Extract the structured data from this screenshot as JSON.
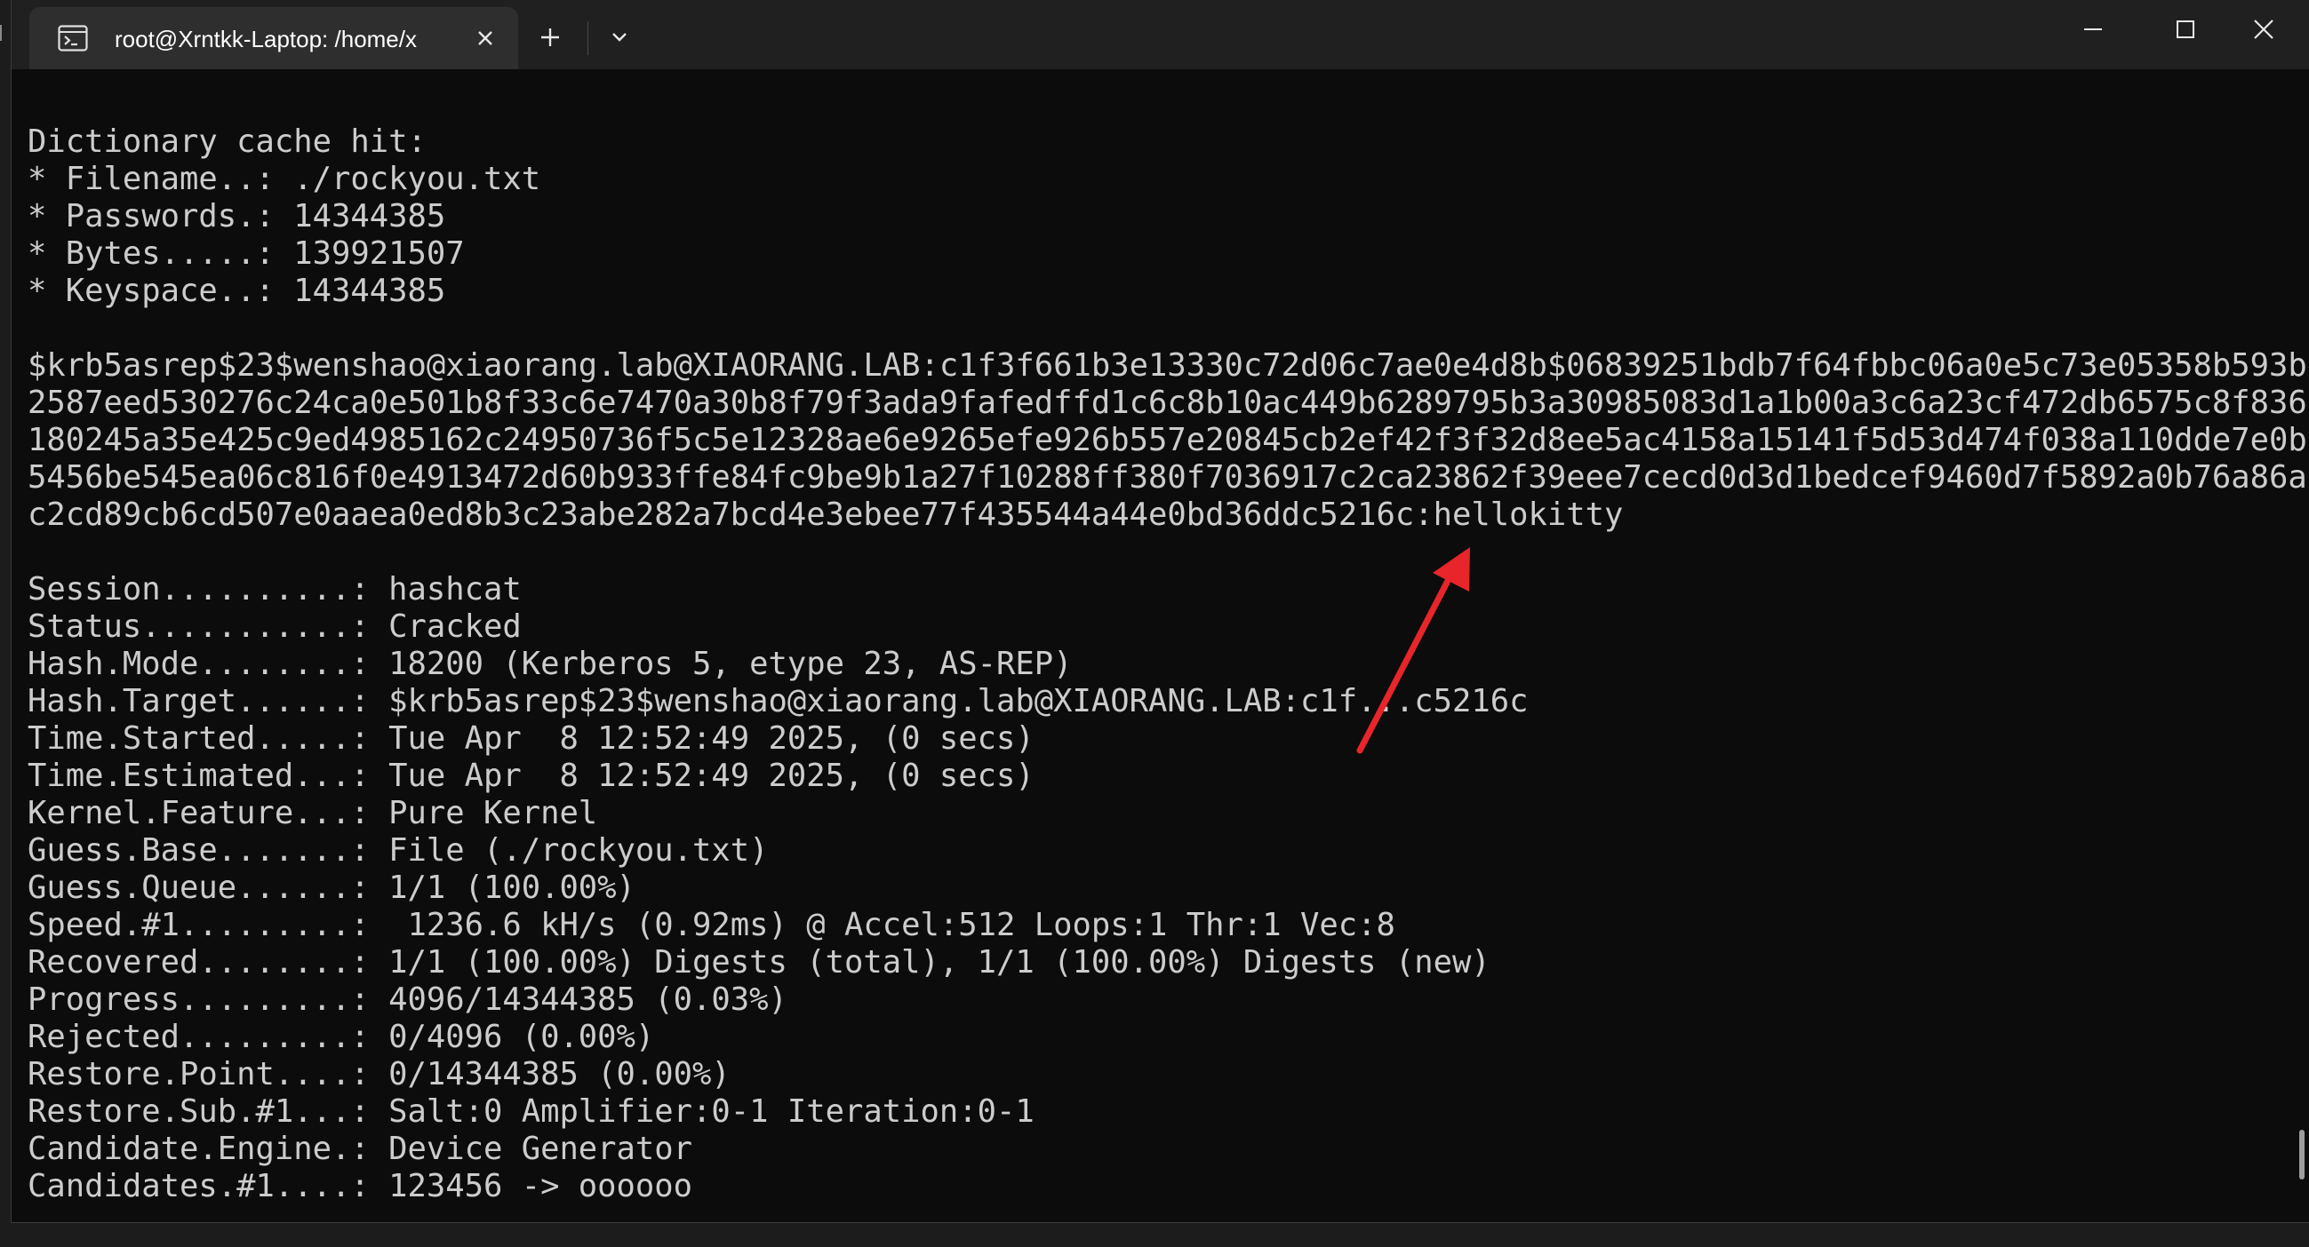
{
  "window": {
    "tab_title": "root@Xrntkk-Laptop: /home/x",
    "icons": {
      "tab_icon": "terminal-icon",
      "tab_close": "close-icon",
      "new_tab": "plus-icon",
      "dropdown": "chevron-down-icon",
      "minimize": "minimize-icon",
      "maximize": "maximize-icon",
      "close": "close-icon"
    }
  },
  "terminal": {
    "lines": [
      "Dictionary cache hit:",
      "* Filename..: ./rockyou.txt",
      "* Passwords.: 14344385",
      "* Bytes.....: 139921507",
      "* Keyspace..: 14344385",
      "",
      "$krb5asrep$23$wenshao@xiaorang.lab@XIAORANG.LAB:c1f3f661b3e13330c72d06c7ae0e4d8b$06839251bdb7f64fbbc06a0e5c73e05358b593b",
      "2587eed530276c24ca0e501b8f33c6e7470a30b8f79f3ada9fafedffd1c6c8b10ac449b6289795b3a30985083d1a1b00a3c6a23cf472db6575c8f836",
      "180245a35e425c9ed4985162c24950736f5c5e12328ae6e9265efe926b557e20845cb2ef42f3f32d8ee5ac4158a15141f5d53d474f038a110dde7e0b",
      "5456be545ea06c816f0e4913472d60b933ffe84fc9be9b1a27f10288ff380f7036917c2ca23862f39eee7cecd0d3d1bedcef9460d7f5892a0b76a86a",
      "c2cd89cb6cd507e0aaea0ed8b3c23abe282a7bcd4e3ebee77f435544a44e0bd36ddc5216c:hellokitty",
      "",
      "Session..........: hashcat",
      "Status...........: Cracked",
      "Hash.Mode........: 18200 (Kerberos 5, etype 23, AS-REP)",
      "Hash.Target......: $krb5asrep$23$wenshao@xiaorang.lab@XIAORANG.LAB:c1f...c5216c",
      "Time.Started.....: Tue Apr  8 12:52:49 2025, (0 secs)",
      "Time.Estimated...: Tue Apr  8 12:52:49 2025, (0 secs)",
      "Kernel.Feature...: Pure Kernel",
      "Guess.Base.......: File (./rockyou.txt)",
      "Guess.Queue......: 1/1 (100.00%)",
      "Speed.#1.........:  1236.6 kH/s (0.92ms) @ Accel:512 Loops:1 Thr:1 Vec:8",
      "Recovered........: 1/1 (100.00%) Digests (total), 1/1 (100.00%) Digests (new)",
      "Progress.........: 4096/14344385 (0.03%)",
      "Rejected.........: 0/4096 (0.00%)",
      "Restore.Point....: 0/14344385 (0.00%)",
      "Restore.Sub.#1...: Salt:0 Amplifier:0-1 Iteration:0-1",
      "Candidate.Engine.: Device Generator",
      "Candidates.#1....: 123456 -> oooooo"
    ]
  },
  "annotation": {
    "icon": "red-arrow-icon",
    "color": "#e8252a"
  },
  "colors": {
    "terminal_bg": "#0c0c0c",
    "titlebar_bg": "#202020",
    "tab_bg": "#2e2e2e",
    "text": "#cccccc"
  }
}
